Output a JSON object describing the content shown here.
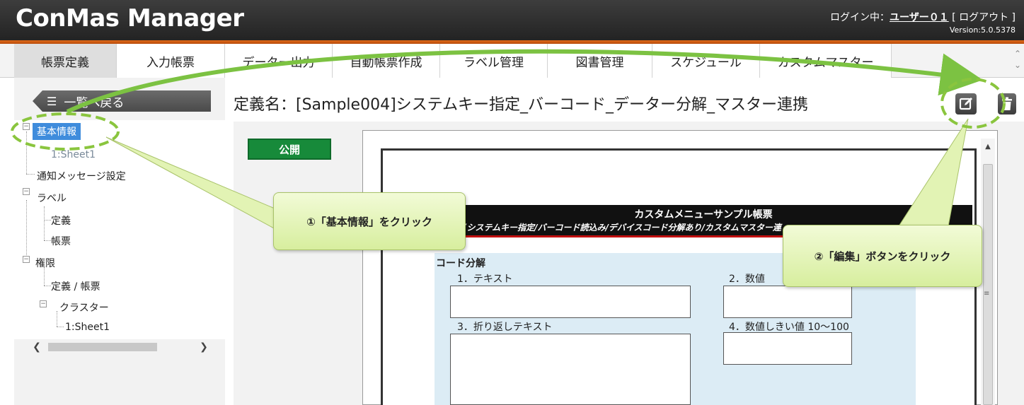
{
  "header": {
    "app_title": "ConMas Manager",
    "login_prefix": "ログイン中：",
    "user_name": "ユーザー０１",
    "logout_label": "[ ログアウト ]",
    "version": "Version:5.0.5378"
  },
  "menu": {
    "tabs": [
      {
        "label": "帳票定義",
        "active": true
      },
      {
        "label": "入力帳票"
      },
      {
        "label": "データー出力"
      },
      {
        "label": "自動帳票作成"
      },
      {
        "label": "ラベル管理"
      },
      {
        "label": "図書管理"
      },
      {
        "label": "スケジュール"
      },
      {
        "label": "カスタムマスター"
      }
    ]
  },
  "sidebar": {
    "back_label": "一覧へ戻る",
    "tree": {
      "basic_info": "基本情報",
      "sheet1": "1:Sheet1",
      "notification": "通知メッセージ設定",
      "label": "ラベル",
      "label_def": "定義",
      "label_form": "帳票",
      "permission": "権限",
      "perm_def_form": "定義 / 帳票",
      "cluster": "クラスター",
      "cluster_sheet1": "1:Sheet1"
    }
  },
  "main": {
    "title": "定義名：[Sample004]システムキー指定_バーコード_データー分解_マスター連携",
    "publish_badge": "公開"
  },
  "preview": {
    "header_title": "カスタムメニューサンプル帳票",
    "header_sub": "(システムキー指定/バーコード読込み/デバイスコード分解あり/カスタムマスター連",
    "section_title": "コード分解",
    "field1": "1．テキスト",
    "field2": "2．数値",
    "field3": "3．折り返しテキスト",
    "field4": "4．数値しきい値 10～100"
  },
  "callouts": {
    "step1": "①「基本情報」をクリック",
    "step2": "②「編集」ボタンをクリック"
  },
  "colors": {
    "header_bg": "#2b2b2b",
    "orange_accent": "#d9601a",
    "selected_blue": "#3f8cdc",
    "publish_green": "#178a3a",
    "callout_green": "#d7ee9e",
    "dashed_highlight": "#8ac53e",
    "arrow_green": "#7cc242"
  },
  "icons": {
    "edit": "edit-icon",
    "delete": "trash-icon",
    "list": "list-icon"
  }
}
